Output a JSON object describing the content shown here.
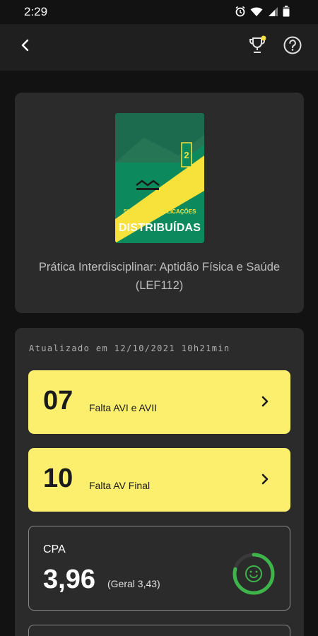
{
  "status_bar": {
    "time": "2:29",
    "icons": [
      "alarm-icon",
      "wifi-icon",
      "signal-icon",
      "battery-icon"
    ]
  },
  "app_bar": {
    "icons": [
      "back-arrow-icon",
      "trophy-icon",
      "help-icon"
    ],
    "notification_dot_color": "#f6e23a"
  },
  "course": {
    "cover": {
      "subtitle": "SISTEMAS E APLICAÇÕES",
      "title": "DISTRIBUÍDAS",
      "colors": {
        "green": "#0c8a5e",
        "yellow": "#f6e23a"
      }
    },
    "title": "Prática Interdisciplinar: Aptidão Física e Saúde (LEF112)"
  },
  "summary": {
    "updated": "Atualizado em 12/10/2021 10h21min",
    "items": [
      {
        "number": "07",
        "label": "Falta AVI e AVII"
      },
      {
        "number": "10",
        "label": "Falta AV Final"
      }
    ],
    "cpa": {
      "label": "CPA",
      "value": "3,96",
      "general": "(Geral 3,43)",
      "ring_color": "#3db54a",
      "icon": "smiley-icon",
      "progress": 0.79
    }
  },
  "colors": {
    "background": "#121212",
    "card": "#2b2b2b",
    "accent_yellow": "#fcef6e"
  }
}
